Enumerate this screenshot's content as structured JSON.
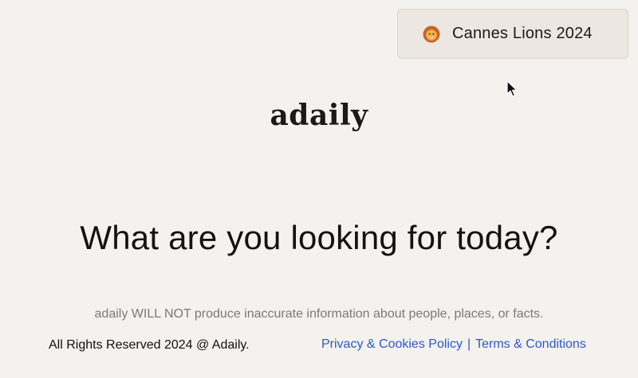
{
  "promo": {
    "icon": "lion-face-icon",
    "label": "Cannes Lions 2024"
  },
  "logo": {
    "text": "adaily"
  },
  "headline": "What are you looking for today?",
  "disclaimer": "adaily WILL NOT produce inaccurate information about people, places, or facts.",
  "footer": {
    "copyright": "All Rights Reserved 2024 @ Adaily.",
    "links": [
      "Privacy & Cookies Policy",
      "Terms & Conditions"
    ],
    "separator": "|"
  },
  "colors": {
    "background": "#f4f2ee",
    "promo_bg": "#ece7e0",
    "link": "#2e57c8",
    "muted_text": "#7d7a75"
  }
}
